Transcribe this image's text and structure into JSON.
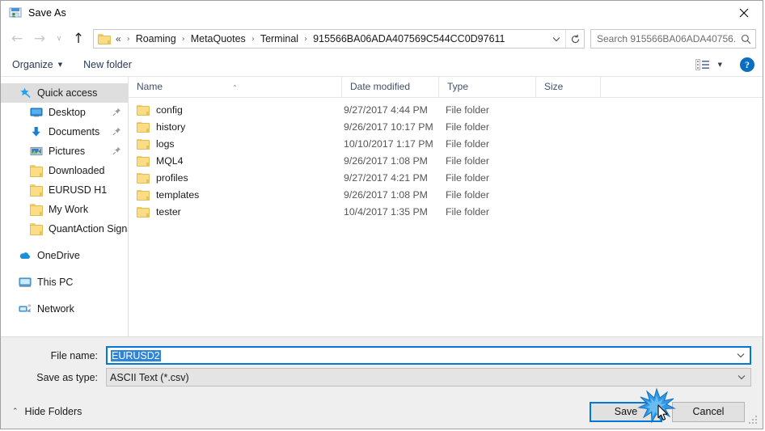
{
  "window": {
    "title": "Save As",
    "app_icon": "save-as-icon",
    "close_label": "✕"
  },
  "nav": {
    "back": "←",
    "forward": "→",
    "recent": "∨",
    "up": "↑",
    "overflow": "«",
    "breadcrumbs": [
      "Roaming",
      "MetaQuotes",
      "Terminal",
      "915566BA06ADA407569C544CC0D97611"
    ],
    "separator": "›",
    "dropdown": "∨",
    "refresh": "↻"
  },
  "search": {
    "placeholder": "Search 915566BA06ADA40756...",
    "icon": "search-icon"
  },
  "toolbar": {
    "organize_label": "Organize",
    "organize_caret": "▼",
    "new_folder_label": "New folder",
    "view_caret": "▼",
    "help_label": "?"
  },
  "sidebar": {
    "groups": [
      {
        "header": {
          "label": "Quick access",
          "icon": "star-pin-icon",
          "selected": true
        },
        "items": [
          {
            "label": "Desktop",
            "icon": "desktop-icon",
            "pinned": true
          },
          {
            "label": "Documents",
            "icon": "documents-download-icon",
            "pinned": true
          },
          {
            "label": "Pictures",
            "icon": "pictures-icon",
            "pinned": true
          },
          {
            "label": "Downloaded",
            "icon": "folder-icon",
            "pinned": false
          },
          {
            "label": "EURUSD H1",
            "icon": "folder-icon",
            "pinned": false
          },
          {
            "label": "My Work",
            "icon": "folder-icon",
            "pinned": false
          },
          {
            "label": "QuantAction Signal",
            "icon": "folder-icon",
            "pinned": false
          }
        ]
      }
    ],
    "roots": [
      {
        "label": "OneDrive",
        "icon": "onedrive-cloud-icon"
      },
      {
        "label": "This PC",
        "icon": "this-pc-icon"
      },
      {
        "label": "Network",
        "icon": "network-icon"
      }
    ]
  },
  "filelist": {
    "columns": [
      {
        "key": "name",
        "label": "Name",
        "sorted": "asc",
        "sort_caret": "⌃"
      },
      {
        "key": "date",
        "label": "Date modified"
      },
      {
        "key": "type",
        "label": "Type"
      },
      {
        "key": "size",
        "label": "Size"
      }
    ],
    "rows": [
      {
        "name": "config",
        "date": "9/27/2017 4:44 PM",
        "type": "File folder",
        "size": ""
      },
      {
        "name": "history",
        "date": "9/26/2017 10:17 PM",
        "type": "File folder",
        "size": ""
      },
      {
        "name": "logs",
        "date": "10/10/2017 1:17 PM",
        "type": "File folder",
        "size": ""
      },
      {
        "name": "MQL4",
        "date": "9/26/2017 1:08 PM",
        "type": "File folder",
        "size": ""
      },
      {
        "name": "profiles",
        "date": "9/27/2017 4:21 PM",
        "type": "File folder",
        "size": ""
      },
      {
        "name": "templates",
        "date": "9/26/2017 1:08 PM",
        "type": "File folder",
        "size": ""
      },
      {
        "name": "tester",
        "date": "10/4/2017 1:35 PM",
        "type": "File folder",
        "size": ""
      }
    ]
  },
  "form": {
    "filename_label": "File name:",
    "filename_value": "EURUSD2",
    "filename_selected": true,
    "filetype_label": "Save as type:",
    "filetype_value": "ASCII Text (*.csv)",
    "combo_arrow": "∨"
  },
  "footer": {
    "hide_folders_label": "Hide Folders",
    "hide_folders_caret": "⌃",
    "save_label": "Save",
    "cancel_label": "Cancel"
  },
  "colors": {
    "accent": "#0078d7",
    "selection": "#2f84d8",
    "folder": "#fcdd86",
    "help_blue": "#0b6ec1",
    "sidebar_selected": "#dedede",
    "form_bg": "#efefef"
  }
}
